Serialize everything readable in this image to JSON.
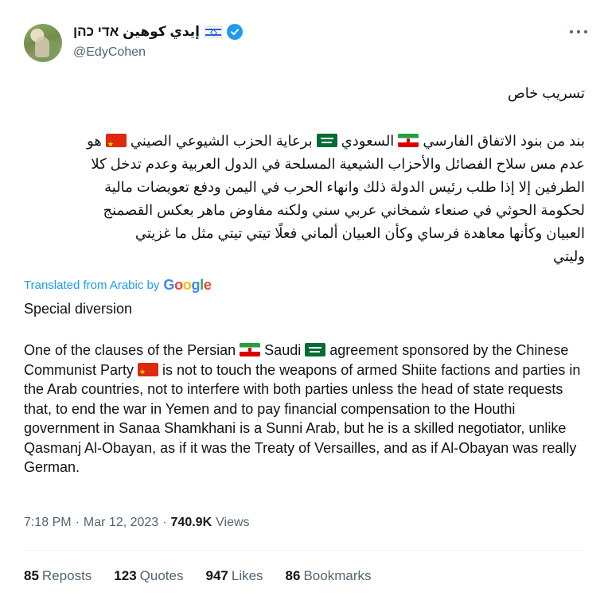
{
  "author": {
    "display_name": "إيدي كوهين אדי כהן",
    "handle": "@EdyCohen",
    "flag_icon": "israel-flag-icon",
    "verified_icon": "verified-badge-icon"
  },
  "tweet": {
    "arabic_title": "تسريب خاص",
    "arabic_lines": [
      {
        "pre": "بند من بنود الاتفاق الفارسي ",
        "flag1": "iran",
        "mid1": " السعودي ",
        "flag2": "saudi",
        "mid2": " برعاية الحزب الشيوعي الصيني ",
        "flag3": "china",
        "post": " هو"
      },
      {
        "text": "عدم مس سلاح الفصائل والأحزاب الشيعية المسلحة في الدول العربية وعدم تدخل كلا"
      },
      {
        "text": "الطرفين إلا إذا طلب رئيس الدولة ذلك وانهاء الحرب في اليمن ودفع تعويضات مالية"
      },
      {
        "text": "لحكومة الحوثي في صنعاء شمخاني عربي سني ولكنه مفاوض ماهر بعكس القصمنج"
      },
      {
        "text": "العبيان وكأنها معاهدة فرساي وكأن العبيان ألماني فعلًا تيتي تيتي مثل ما غزيتي"
      },
      {
        "text": "وليتي"
      }
    ],
    "translated_label": "Translated from Arabic by",
    "google_letters": [
      "G",
      "o",
      "o",
      "g",
      "l",
      "e"
    ],
    "english_title": "Special diversion",
    "english_body": {
      "part1": "One of the clauses of the Persian ",
      "part2": " Saudi ",
      "part3": " agreement sponsored by the Chinese Communist Party ",
      "part4": " is not to touch the weapons of armed Shiite factions and parties in the Arab countries, not to interfere with both parties unless the head of state requests that, to end the war in Yemen and to pay financial compensation to the Houthi government in Sanaa Shamkhani is a Sunni Arab, but he is a skilled negotiator, unlike Qasmanj Al-Obayan, as if it was the Treaty of Versailles, and as if Al-Obayan was really German."
    },
    "time": "7:18 PM",
    "separator": "·",
    "date": "Mar 12, 2023",
    "views_count": "740.9K",
    "views_label": "Views"
  },
  "stats": {
    "reposts_count": "85",
    "reposts_label": "Reposts",
    "quotes_count": "123",
    "quotes_label": "Quotes",
    "likes_count": "947",
    "likes_label": "Likes",
    "bookmarks_count": "86",
    "bookmarks_label": "Bookmarks"
  },
  "colors": {
    "accent": "#1d9bf0",
    "text": "#0f1419",
    "secondary": "#536471"
  }
}
